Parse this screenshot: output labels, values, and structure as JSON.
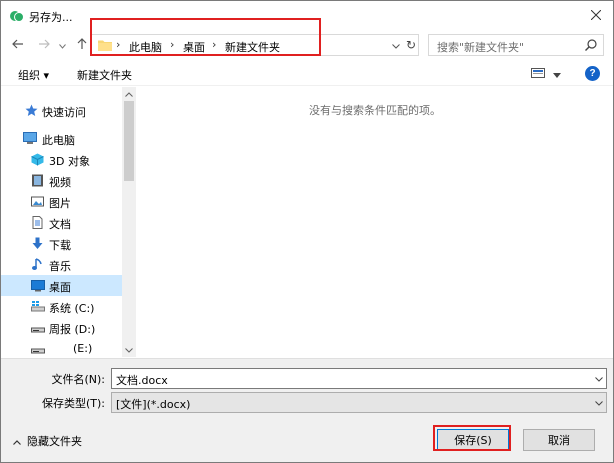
{
  "window": {
    "title": "另存为..."
  },
  "address": {
    "crumbs": [
      "此电脑",
      "桌面",
      "新建文件夹"
    ],
    "separator": "›",
    "search_placeholder": "搜索\"新建文件夹\""
  },
  "toolbar": {
    "organize": "组织 ▾",
    "new_folder": "新建文件夹",
    "help": "?"
  },
  "nav": {
    "items": [
      {
        "label": "快速访问",
        "icon": "star-icon"
      },
      {
        "label": "此电脑",
        "icon": "computer-icon"
      },
      {
        "label": "3D 对象",
        "icon": "cube-icon"
      },
      {
        "label": "视频",
        "icon": "video-icon"
      },
      {
        "label": "图片",
        "icon": "picture-icon"
      },
      {
        "label": "文档",
        "icon": "document-icon"
      },
      {
        "label": "下载",
        "icon": "download-icon"
      },
      {
        "label": "音乐",
        "icon": "music-icon"
      },
      {
        "label": "桌面",
        "icon": "desktop-icon",
        "selected": true
      },
      {
        "label": "系统 (C:)",
        "icon": "drive-icon"
      },
      {
        "label": "周报 (D:)",
        "icon": "drive-icon"
      },
      {
        "label": "(E:)",
        "icon": "drive-icon"
      }
    ]
  },
  "content": {
    "empty_message": "没有与搜索条件匹配的项。"
  },
  "form": {
    "filename_label": "文件名(N):",
    "filename_value": "文档.docx",
    "filetype_label": "保存类型(T):",
    "filetype_value": "[文件](*.docx)"
  },
  "footer": {
    "hide_folders": "隐藏文件夹",
    "save": "保存(S)",
    "cancel": "取消"
  },
  "colors": {
    "highlight": "#e02020",
    "selected_bg": "#cce8ff",
    "accent": "#0078d7"
  }
}
